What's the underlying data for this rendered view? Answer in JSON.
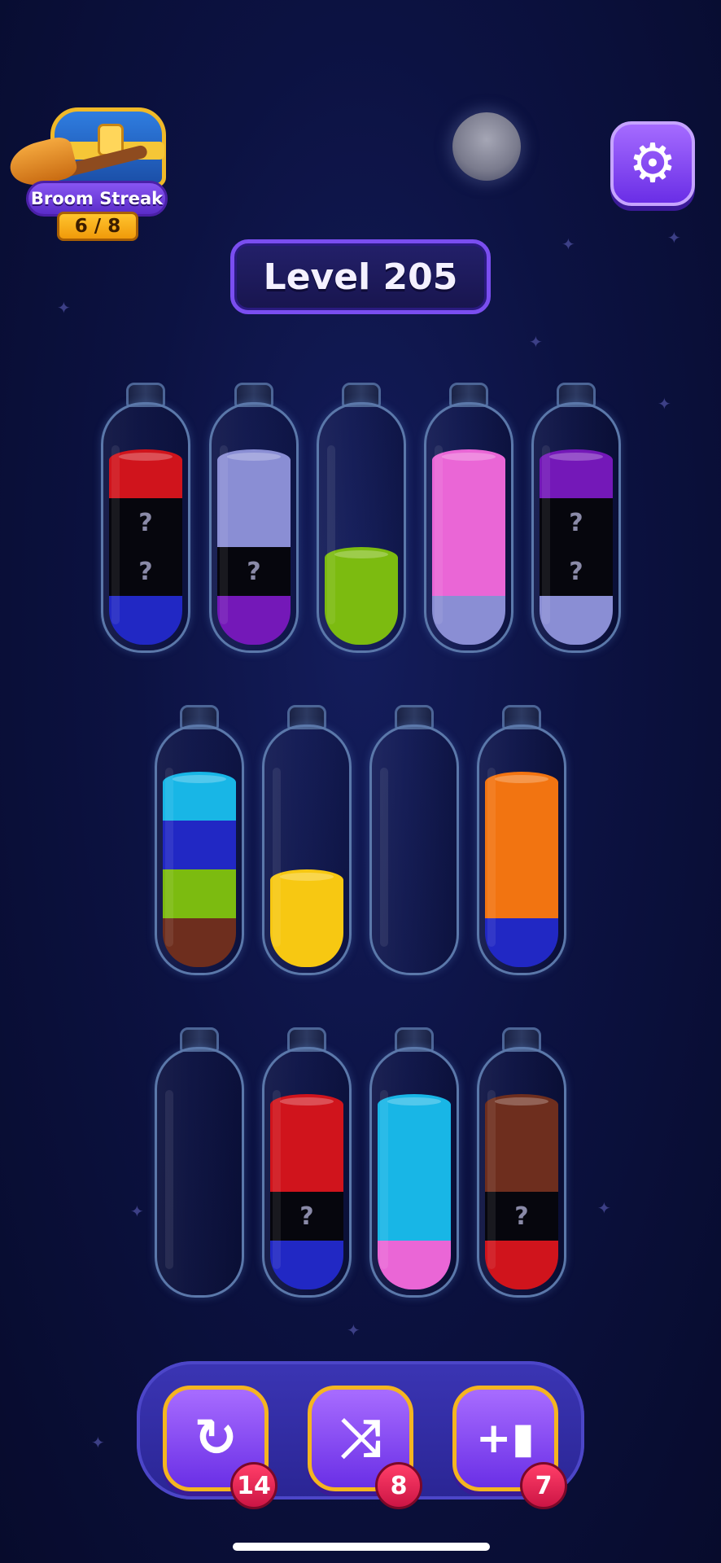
{
  "streak": {
    "title": "Broom Streak",
    "count": "6 / 8",
    "icon": "chest-broom-icon"
  },
  "level": {
    "label": "Level 205"
  },
  "settings": {
    "icon": "gear-icon",
    "glyph": "⚙"
  },
  "colors": {
    "red": "#d0141c",
    "lavender": "#8a8ed4",
    "green": "#7cbb10",
    "pink": "#ea66d6",
    "purple": "#7418b8",
    "blue": "#2128c4",
    "cyan": "#18b6e6",
    "yellow": "#f7c812",
    "orange": "#f27411",
    "brown": "#6e2e1e",
    "hidden": "#06060d"
  },
  "tubes": [
    {
      "segments": [
        "red",
        "hidden",
        "hidden",
        "blue"
      ]
    },
    {
      "segments": [
        "lavender",
        "lavender",
        "hidden",
        "purple"
      ]
    },
    {
      "segments": [
        "green",
        "green"
      ]
    },
    {
      "segments": [
        "pink",
        "pink",
        "pink",
        "lavender"
      ]
    },
    {
      "segments": [
        "purple",
        "hidden",
        "hidden",
        "lavender"
      ]
    },
    {
      "segments": [
        "cyan",
        "blue",
        "green",
        "brown"
      ]
    },
    {
      "segments": [
        "yellow",
        "yellow"
      ]
    },
    {
      "segments": []
    },
    {
      "segments": [
        "orange",
        "orange",
        "orange",
        "blue"
      ]
    },
    {
      "segments": []
    },
    {
      "segments": [
        "red",
        "red",
        "hidden",
        "blue"
      ]
    },
    {
      "segments": [
        "cyan",
        "cyan",
        "cyan",
        "pink"
      ]
    },
    {
      "segments": [
        "brown",
        "brown",
        "hidden",
        "red"
      ]
    }
  ],
  "hidden_mark": "?",
  "powerups": [
    {
      "name": "undo",
      "icon": "undo-icon",
      "glyph": "↻",
      "count": "14"
    },
    {
      "name": "shuffle",
      "icon": "shuffle-icon",
      "glyph": "⤨",
      "count": "8"
    },
    {
      "name": "add-bottle",
      "icon": "add-bottle-icon",
      "glyph": "+▮",
      "count": "7"
    }
  ]
}
